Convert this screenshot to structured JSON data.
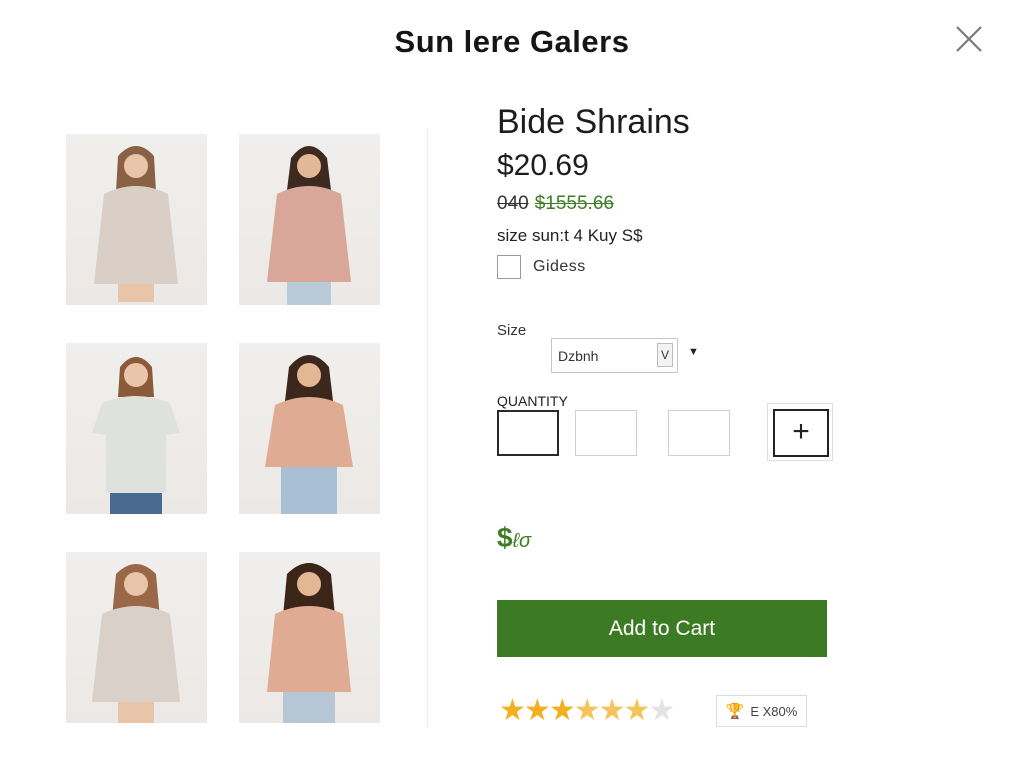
{
  "modal": {
    "title": "Sun lere Galers",
    "close_icon": "close-icon"
  },
  "gallery": {
    "thumbnails": [
      {
        "label": "thumb-1",
        "color": "#d9cfc6"
      },
      {
        "label": "thumb-2",
        "color": "#d9a79a"
      },
      {
        "label": "thumb-3",
        "color": "#dfe2dc"
      },
      {
        "label": "thumb-4",
        "color": "#e0ab93"
      },
      {
        "label": "thumb-5",
        "color": "#d8d0c9"
      },
      {
        "label": "thumb-6",
        "color": "#e0ab93"
      }
    ]
  },
  "product": {
    "name": "Bide Shrains",
    "price": "$20.69",
    "old_price": "040",
    "sale_price": "$1555.66",
    "size_note": "size sun:t 4 Kuy S$",
    "checkbox_label": "Gidess"
  },
  "size": {
    "label": "Size",
    "selected": "Dzbnh",
    "toggle_glyph": "V",
    "caret_glyph": "▼"
  },
  "quantity": {
    "label": "QUANTITY",
    "plus_glyph": "+"
  },
  "total": {
    "symbol": "$",
    "value": "ℓσ"
  },
  "cart": {
    "add_label": "Add to Cart"
  },
  "rating": {
    "stars": 6,
    "badge_icon": "🏆",
    "badge_text": "E X80%"
  },
  "colors": {
    "accent": "#3d7a24",
    "star": "#f2b01e"
  }
}
